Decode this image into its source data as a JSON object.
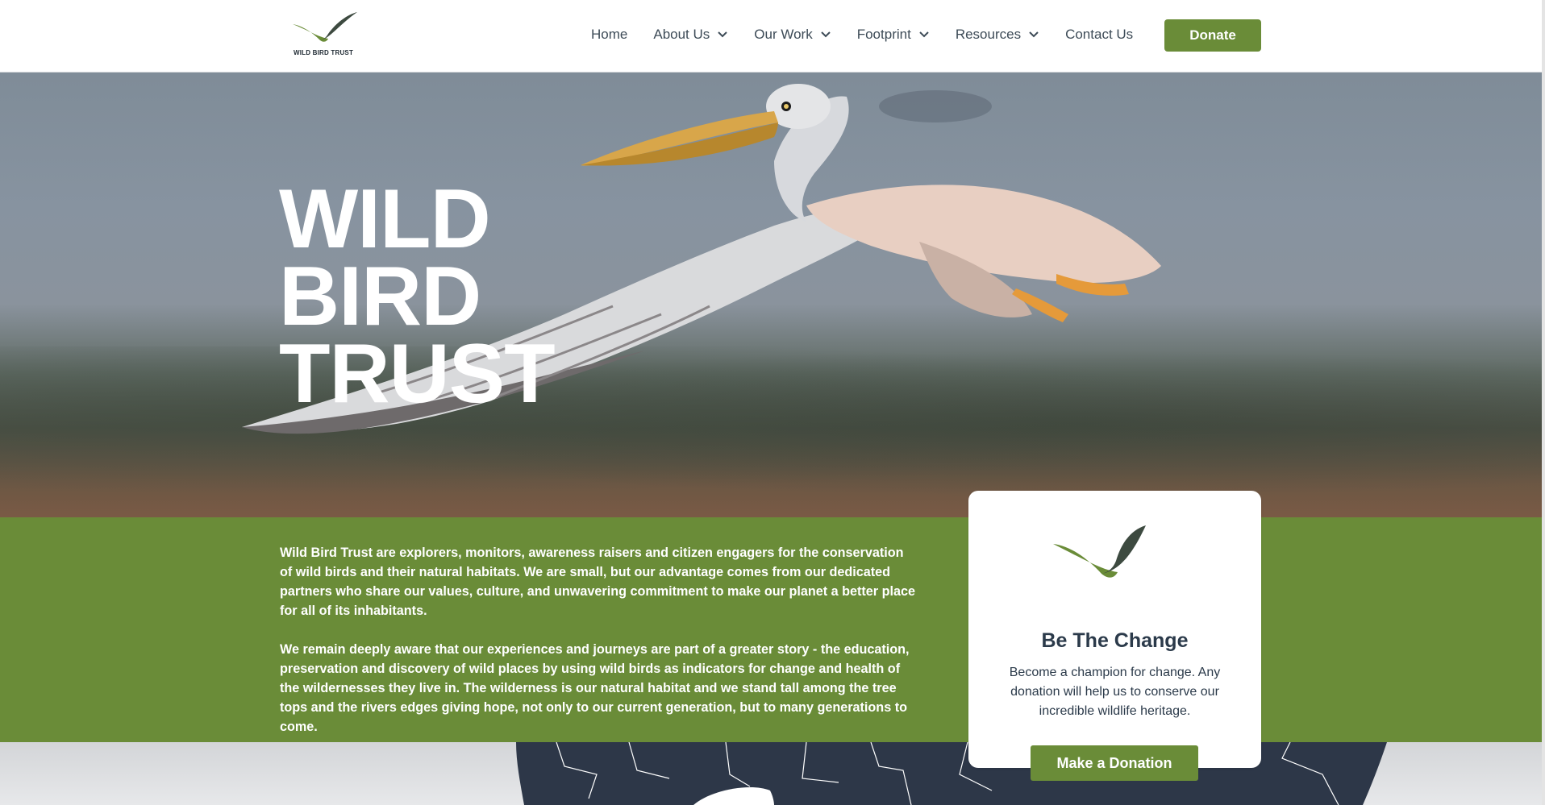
{
  "brand": {
    "logo_text": "WILD BIRD TRUST",
    "accent_color": "#6a8c38",
    "dark_color": "#3d4a40"
  },
  "nav": {
    "items": [
      {
        "label": "Home",
        "has_dropdown": false
      },
      {
        "label": "About Us",
        "has_dropdown": true
      },
      {
        "label": "Our Work",
        "has_dropdown": true
      },
      {
        "label": "Footprint",
        "has_dropdown": true
      },
      {
        "label": "Resources",
        "has_dropdown": true
      },
      {
        "label": "Contact Us",
        "has_dropdown": false
      }
    ],
    "donate_label": "Donate"
  },
  "hero": {
    "title_lines": [
      "WILD",
      "BIRD",
      "TRUST"
    ]
  },
  "intro": {
    "p1": "Wild Bird Trust are explorers, monitors, awareness raisers and citizen engagers for the conservation of wild birds and their natural habitats. We are small, but our advantage comes from our dedicated partners who share our values, culture, and unwavering commitment to make our planet a better place for all of its inhabitants.",
    "p2": "We remain deeply aware that our experiences and journeys are part of a greater story - the education, preservation and discovery of wild places by using wild birds as indicators for change and health of the wildernesses they live in. The wilderness is our natural habitat and we stand tall among the tree tops and the rivers edges giving hope, not only to our current generation, but to many generations to come."
  },
  "card": {
    "title": "Be The Change",
    "text": "Become a champion for change. Any donation will help us to conserve our incredible wildlife heritage.",
    "button_label": "Make a Donation"
  }
}
